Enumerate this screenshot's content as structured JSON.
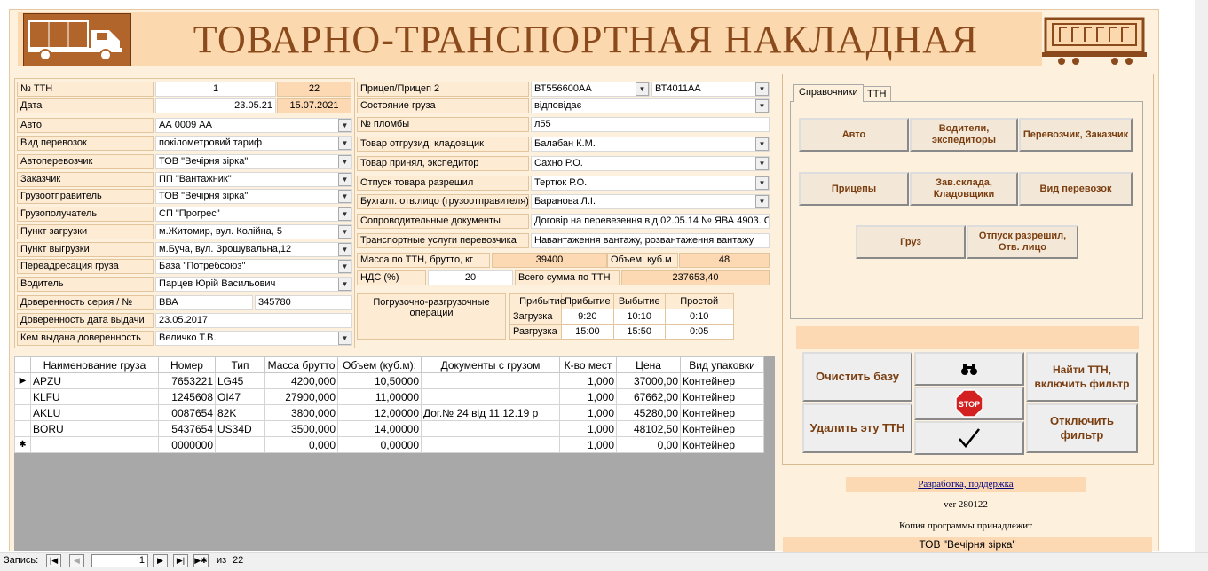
{
  "header": {
    "title": "ТОВАРНО-ТРАНСПОРТНАЯ НАКЛАДНАЯ"
  },
  "left": {
    "ttn_label": "№ ТТН",
    "ttn_value": "1",
    "ttn_count": "22",
    "date_label": "Дата",
    "date_value": "23.05.21",
    "date_value2": "15.07.2021",
    "auto_label": "Авто",
    "auto_value": "АА 0009 АА",
    "vid_label": "Вид перевозок",
    "vid_value": "покілометровий тариф",
    "carrier_label": "Автоперевозчик",
    "carrier_value": "ТОВ \"Вечірня зірка\"",
    "customer_label": "Заказчик",
    "customer_value": "ПП \"Вантажник\"",
    "shipper_label": "Грузоотправитель",
    "shipper_value": "ТОВ \"Вечірня зірка\"",
    "consignee_label": "Грузополучатель",
    "consignee_value": "СП \"Прогрес\"",
    "load_label": "Пункт загрузки",
    "load_value": "м.Житомир, вул. Колійна, 5",
    "unload_label": "Пункт выгрузки",
    "unload_value": "м.Буча, вул. Зрошувальна,12",
    "redirect_label": "Переадресация груза",
    "redirect_value": "База \"Потребсоюз\"",
    "driver_label": "Водитель",
    "driver_value": "Парцев Юрій Васильович",
    "proxy_label": "Доверенность серия / №",
    "proxy_series": "ВВА",
    "proxy_number": "345780",
    "proxy_date_label": "Доверенность дата выдачи",
    "proxy_date_value": "23.05.2017",
    "proxy_by_label": "Кем выдана доверенность",
    "proxy_by_value": "Величко Т.В."
  },
  "middle": {
    "trailer_label": "Прицеп/Прицеп 2",
    "trailer1": "ВТ556600АА",
    "trailer2": "ВТ4011АА",
    "cargo_state_label": "Состояние груза",
    "cargo_state_value": "відповідає",
    "seal_label": "№ пломбы",
    "seal_value": "л55",
    "shipped_label": "Товар отгрузид, кладовщик",
    "shipped_value": "Балабан К.М.",
    "received_label": "Товар принял, экспедитор",
    "received_value": "Сахно Р.О.",
    "release_label": "Отпуск товара разрешил",
    "release_value": "Тертюк Р.О.",
    "accountant_label": "Бухгалт. отв.лицо (грузоотправителя)",
    "accountant_value": "Баранова Л.І.",
    "docs_label": "Сопроводительные документы",
    "docs_value": "Договір на перевезення від 02.05.14 № ЯВА 4903. С",
    "services_label": "Транспортные услуги перевозчика",
    "services_value": "Навантаження вантажу, розвантаження вантажу",
    "mass_label": "Масса по ТТН, брутто, кг",
    "mass_value": "39400",
    "volume_label": "Объем, куб.м",
    "volume_value": "48",
    "vat_label": "НДС (%)",
    "vat_value": "20",
    "total_label": "Всего сумма по ТТН",
    "total_value": "237653,40",
    "ops_label": "Погрузочно-разгрузочные операции",
    "ops_headers": [
      "Прибытие",
      "Прибытие",
      "Выбытие",
      "Простой"
    ],
    "ops_rows": [
      [
        "Загрузка",
        "9:20",
        "10:10",
        "0:10"
      ],
      [
        "Разгрузка",
        "15:00",
        "15:50",
        "0:05"
      ]
    ]
  },
  "tabs": [
    "Справочники",
    "ТТН"
  ],
  "ref_buttons": [
    "Авто",
    "Водители, экспедиторы",
    "Перевозчик, Заказчик",
    "Прицепы",
    "Зав.склада, Кладовщики",
    "Вид перевозок",
    "Груз",
    "Отпуск разрешил, Отв. лицо"
  ],
  "actions": {
    "clear": "Очистить базу",
    "delete": "Удалить эту ТТН",
    "find": "Найти ТТН, включить фильтр",
    "unfilter": "Отключить фильтр",
    "stop": "STOP"
  },
  "footer": {
    "dev_link": "Разработка, поддержка",
    "version": "ver 280122",
    "copy_text": "Копия программы принадлежит",
    "owner": "ТОВ \"Вечірня зірка\""
  },
  "grid": {
    "headers": [
      "Наименование груза",
      "Номер",
      "Тип",
      "Масса брутто",
      "Объем (куб.м):",
      "Документы с грузом",
      "К-во мест",
      "Цена",
      "Вид упаковки"
    ],
    "rows": [
      [
        "APZU",
        "7653221",
        "LG45",
        "4200,000",
        "10,50000",
        "",
        "1,000",
        "37000,00",
        "Контейнер"
      ],
      [
        "KLFU",
        "1245608",
        "OI47",
        "27900,000",
        "11,00000",
        "",
        "1,000",
        "67662,00",
        "Контейнер"
      ],
      [
        "AKLU",
        "0087654",
        "82K",
        "3800,000",
        "12,00000",
        "Дог.№ 24 від 11.12.19 р",
        "1,000",
        "45280,00",
        "Контейнер"
      ],
      [
        "BORU",
        "5437654",
        "US34D",
        "3500,000",
        "14,00000",
        "",
        "1,000",
        "48102,50",
        "Контейнер"
      ],
      [
        "",
        "0000000",
        "",
        "0,000",
        "0,00000",
        "",
        "1,000",
        "0,00",
        "Контейнер"
      ]
    ]
  },
  "status": {
    "record_label": "Запись:",
    "current": "1",
    "of": "из",
    "total": "22"
  },
  "colors": {
    "accent": "#8b4a1c",
    "panel": "#fdf0dd",
    "field_label": "#fdebd4",
    "orange_field": "#fcd9b3"
  }
}
